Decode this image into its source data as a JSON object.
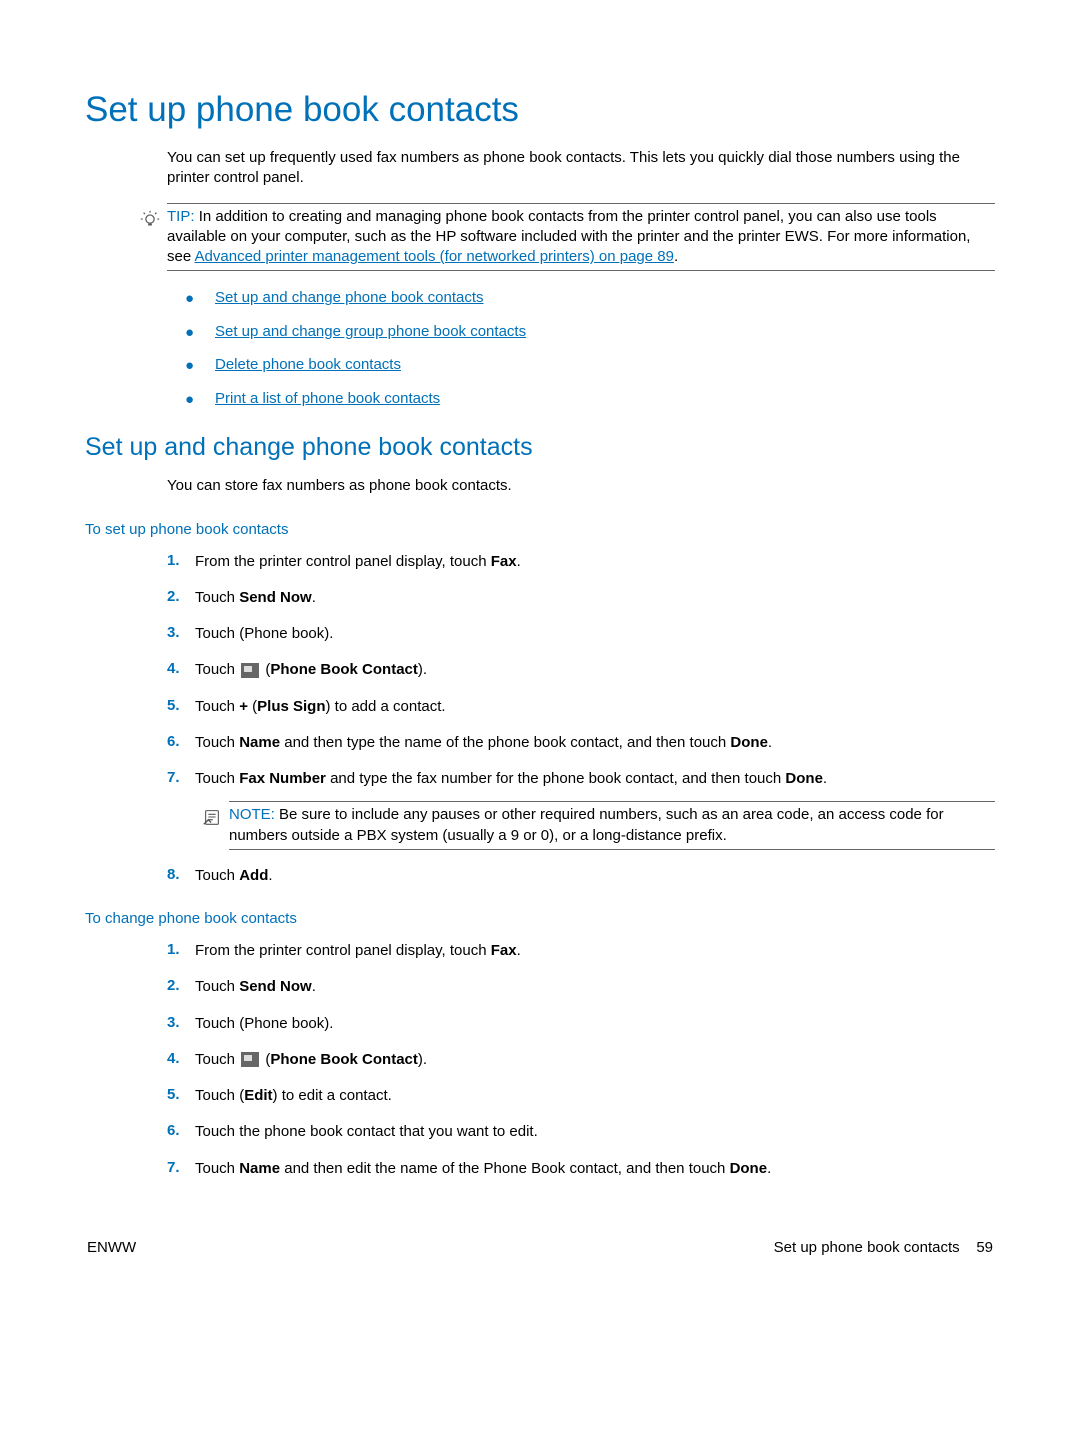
{
  "title": "Set up phone book contacts",
  "intro": "You can set up frequently used fax numbers as phone book contacts. This lets you quickly dial those numbers using the printer control panel.",
  "tip": {
    "label": "TIP:",
    "text_before_link": "In addition to creating and managing phone book contacts from the printer control panel, you can also use tools available on your computer, such as the HP software included with the printer and the printer EWS. For more information, see ",
    "link_text": "Advanced printer management tools (for networked printers) on page 89",
    "text_after_link": "."
  },
  "toc": [
    "Set up and change phone book contacts",
    "Set up and change group phone book contacts",
    "Delete phone book contacts",
    "Print a list of phone book contacts"
  ],
  "section1": {
    "heading": "Set up and change phone book contacts",
    "intro": "You can store fax numbers as phone book contacts.",
    "proc1": {
      "heading": "To set up phone book contacts",
      "steps": {
        "s1_pre": "From the printer control panel display, touch ",
        "s1_bold": "Fax",
        "s1_post": ".",
        "s2_pre": "Touch ",
        "s2_bold": "Send Now",
        "s2_post": ".",
        "s3": "Touch      (Phone book).",
        "s4_pre": "Touch ",
        "s4_bold": "Phone Book Contact",
        "s4_post": ").",
        "s5_pre": "Touch ",
        "s5_sign": "+",
        "s5_mid": " (",
        "s5_bold": "Plus Sign",
        "s5_post": ") to add a contact.",
        "s6_pre": "Touch ",
        "s6_b1": "Name",
        "s6_mid": " and then type the name of the phone book contact, and then touch ",
        "s6_b2": "Done",
        "s6_post": ".",
        "s7_pre": "Touch ",
        "s7_b1": "Fax Number",
        "s7_mid": " and type the fax number for the phone book contact, and then touch ",
        "s7_b2": "Done",
        "s7_post": ".",
        "note_label": "NOTE:",
        "note_text": "Be sure to include any pauses or other required numbers, such as an area code, an access code for numbers outside a PBX system (usually a 9 or 0), or a long-distance prefix.",
        "s8_pre": "Touch ",
        "s8_bold": "Add",
        "s8_post": "."
      }
    },
    "proc2": {
      "heading": "To change phone book contacts",
      "steps": {
        "s1_pre": "From the printer control panel display, touch ",
        "s1_bold": "Fax",
        "s1_post": ".",
        "s2_pre": "Touch ",
        "s2_bold": "Send Now",
        "s2_post": ".",
        "s3": "Touch      (Phone book).",
        "s4_pre": "Touch ",
        "s4_bold": "Phone Book Contact",
        "s4_post": ").",
        "s5_pre": "Touch      (",
        "s5_bold": "Edit",
        "s5_post": ") to edit a contact.",
        "s6": "Touch the phone book contact that you want to edit.",
        "s7_pre": "Touch ",
        "s7_b1": "Name",
        "s7_mid": " and then edit the name of the Phone Book contact, and then touch ",
        "s7_b2": "Done",
        "s7_post": "."
      }
    }
  },
  "footer": {
    "left": "ENWW",
    "right_label": "Set up phone book contacts",
    "page": "59"
  },
  "nums": [
    "1.",
    "2.",
    "3.",
    "4.",
    "5.",
    "6.",
    "7.",
    "8."
  ]
}
